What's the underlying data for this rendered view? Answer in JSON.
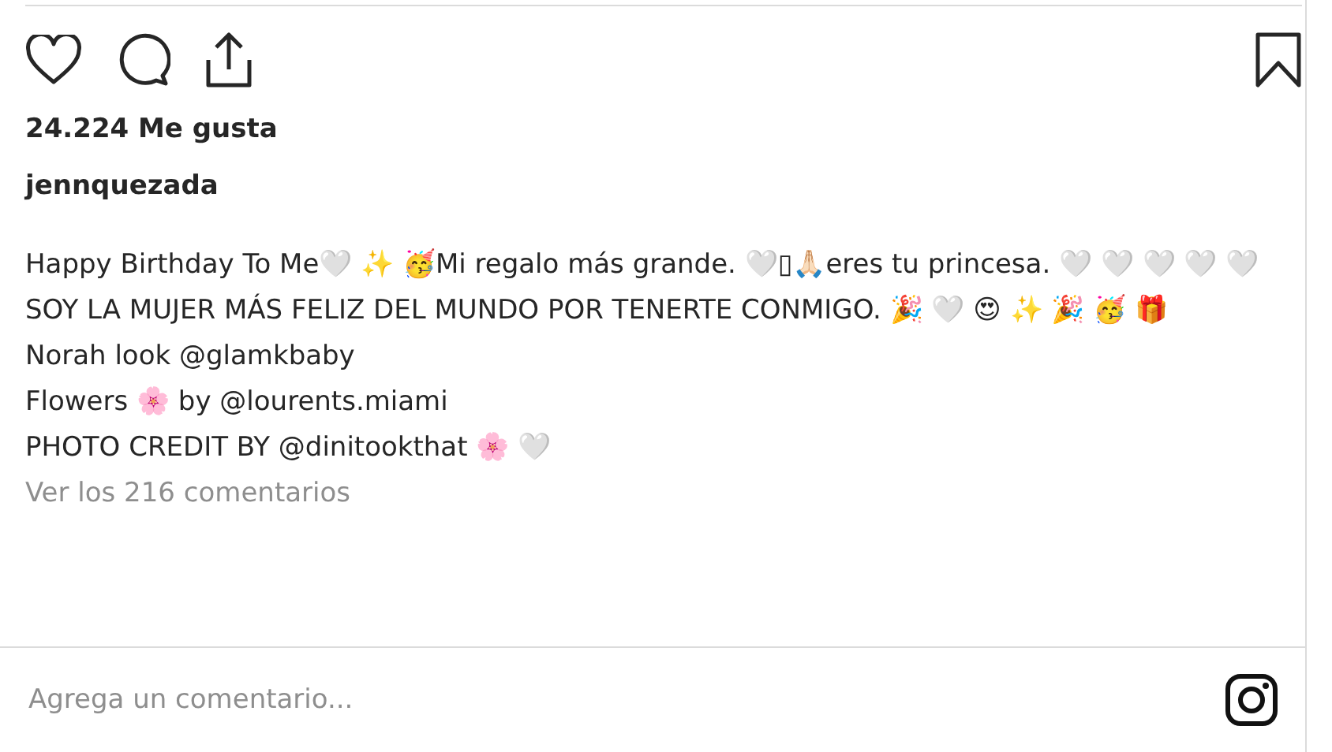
{
  "actions": {
    "liked": false,
    "saved": false
  },
  "likes": "24.224 Me gusta",
  "username": "jennquezada",
  "caption": [
    "Happy Birthday To Me🤍 ✨ 🥳Mi regalo más grande. 🤍▯🙏🏻eres tu princesa. 🤍 🤍 🤍 🤍 🤍",
    "SOY LA MUJER MÁS FELIZ DEL MUNDO POR TENERTE CONMIGO. 🎉 🤍 😍 ✨ 🎉 🥳 🎁",
    "Norah look @glamkbaby",
    "Flowers 🌸 by @lourents.miami",
    "PHOTO CREDIT BY @dinitookthat 🌸 🤍"
  ],
  "view_comments": "Ver los 216 comentarios",
  "comment": {
    "placeholder": "Agrega un comentario..."
  }
}
